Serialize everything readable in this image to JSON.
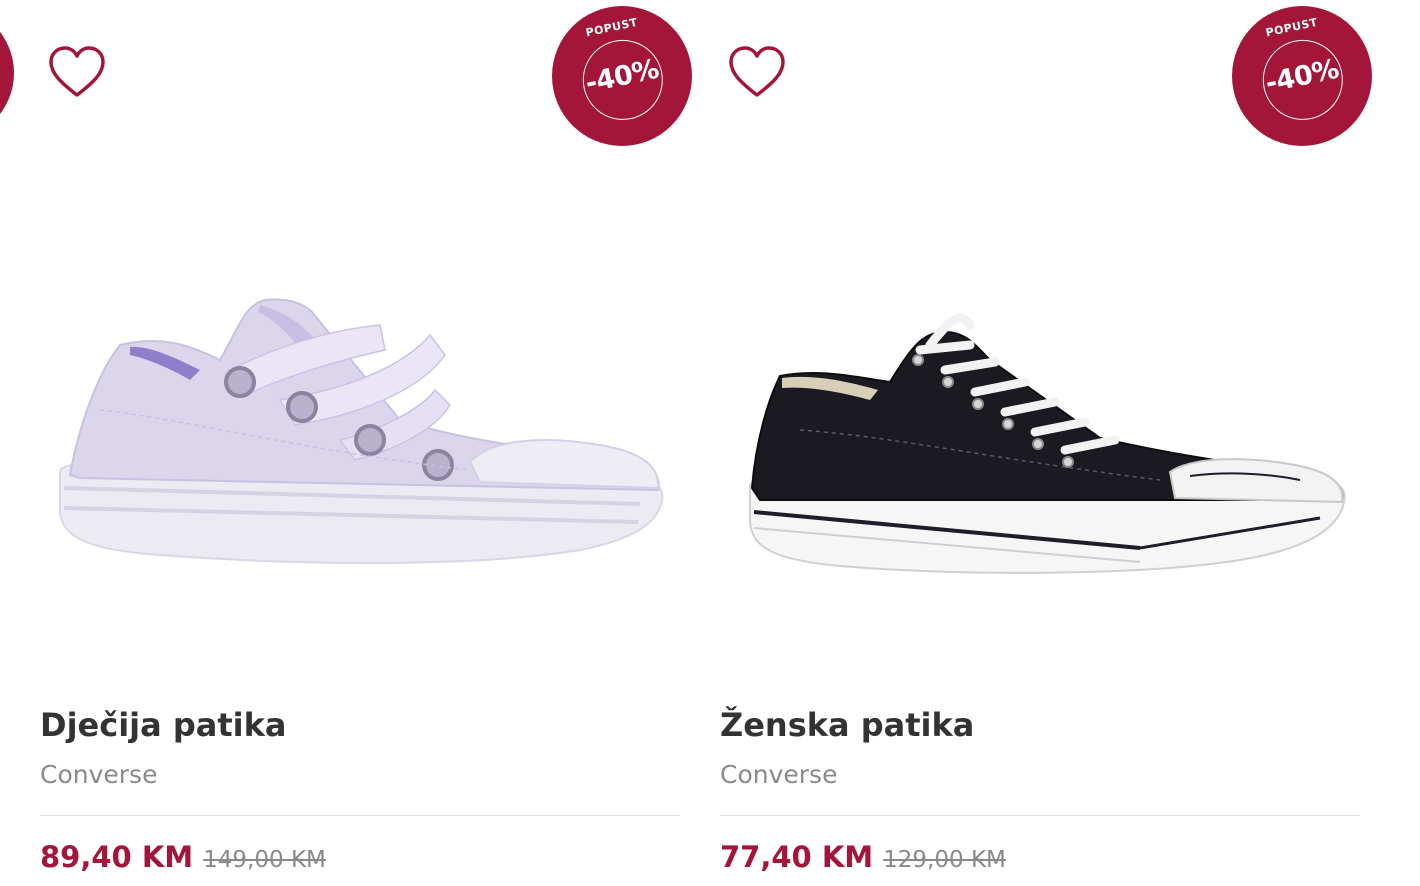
{
  "colors": {
    "accent": "#a3163a",
    "title": "#333333",
    "muted": "#8a8a8a",
    "divider": "#dddddd"
  },
  "products": [
    {
      "title": "Dječija patika",
      "brand": "Converse",
      "price_now": "89,40 KM",
      "price_old": "149,00 KM",
      "badge_label": "POPUST",
      "badge_value": "-40%",
      "wishlist_icon": "heart-outline-icon",
      "image": "lilac-low-top-sneaker"
    },
    {
      "title": "Ženska patika",
      "brand": "Converse",
      "price_now": "77,40 KM",
      "price_old": "129,00 KM",
      "badge_label": "POPUST",
      "badge_value": "-40%",
      "wishlist_icon": "heart-outline-icon",
      "image": "black-low-top-sneaker"
    }
  ]
}
